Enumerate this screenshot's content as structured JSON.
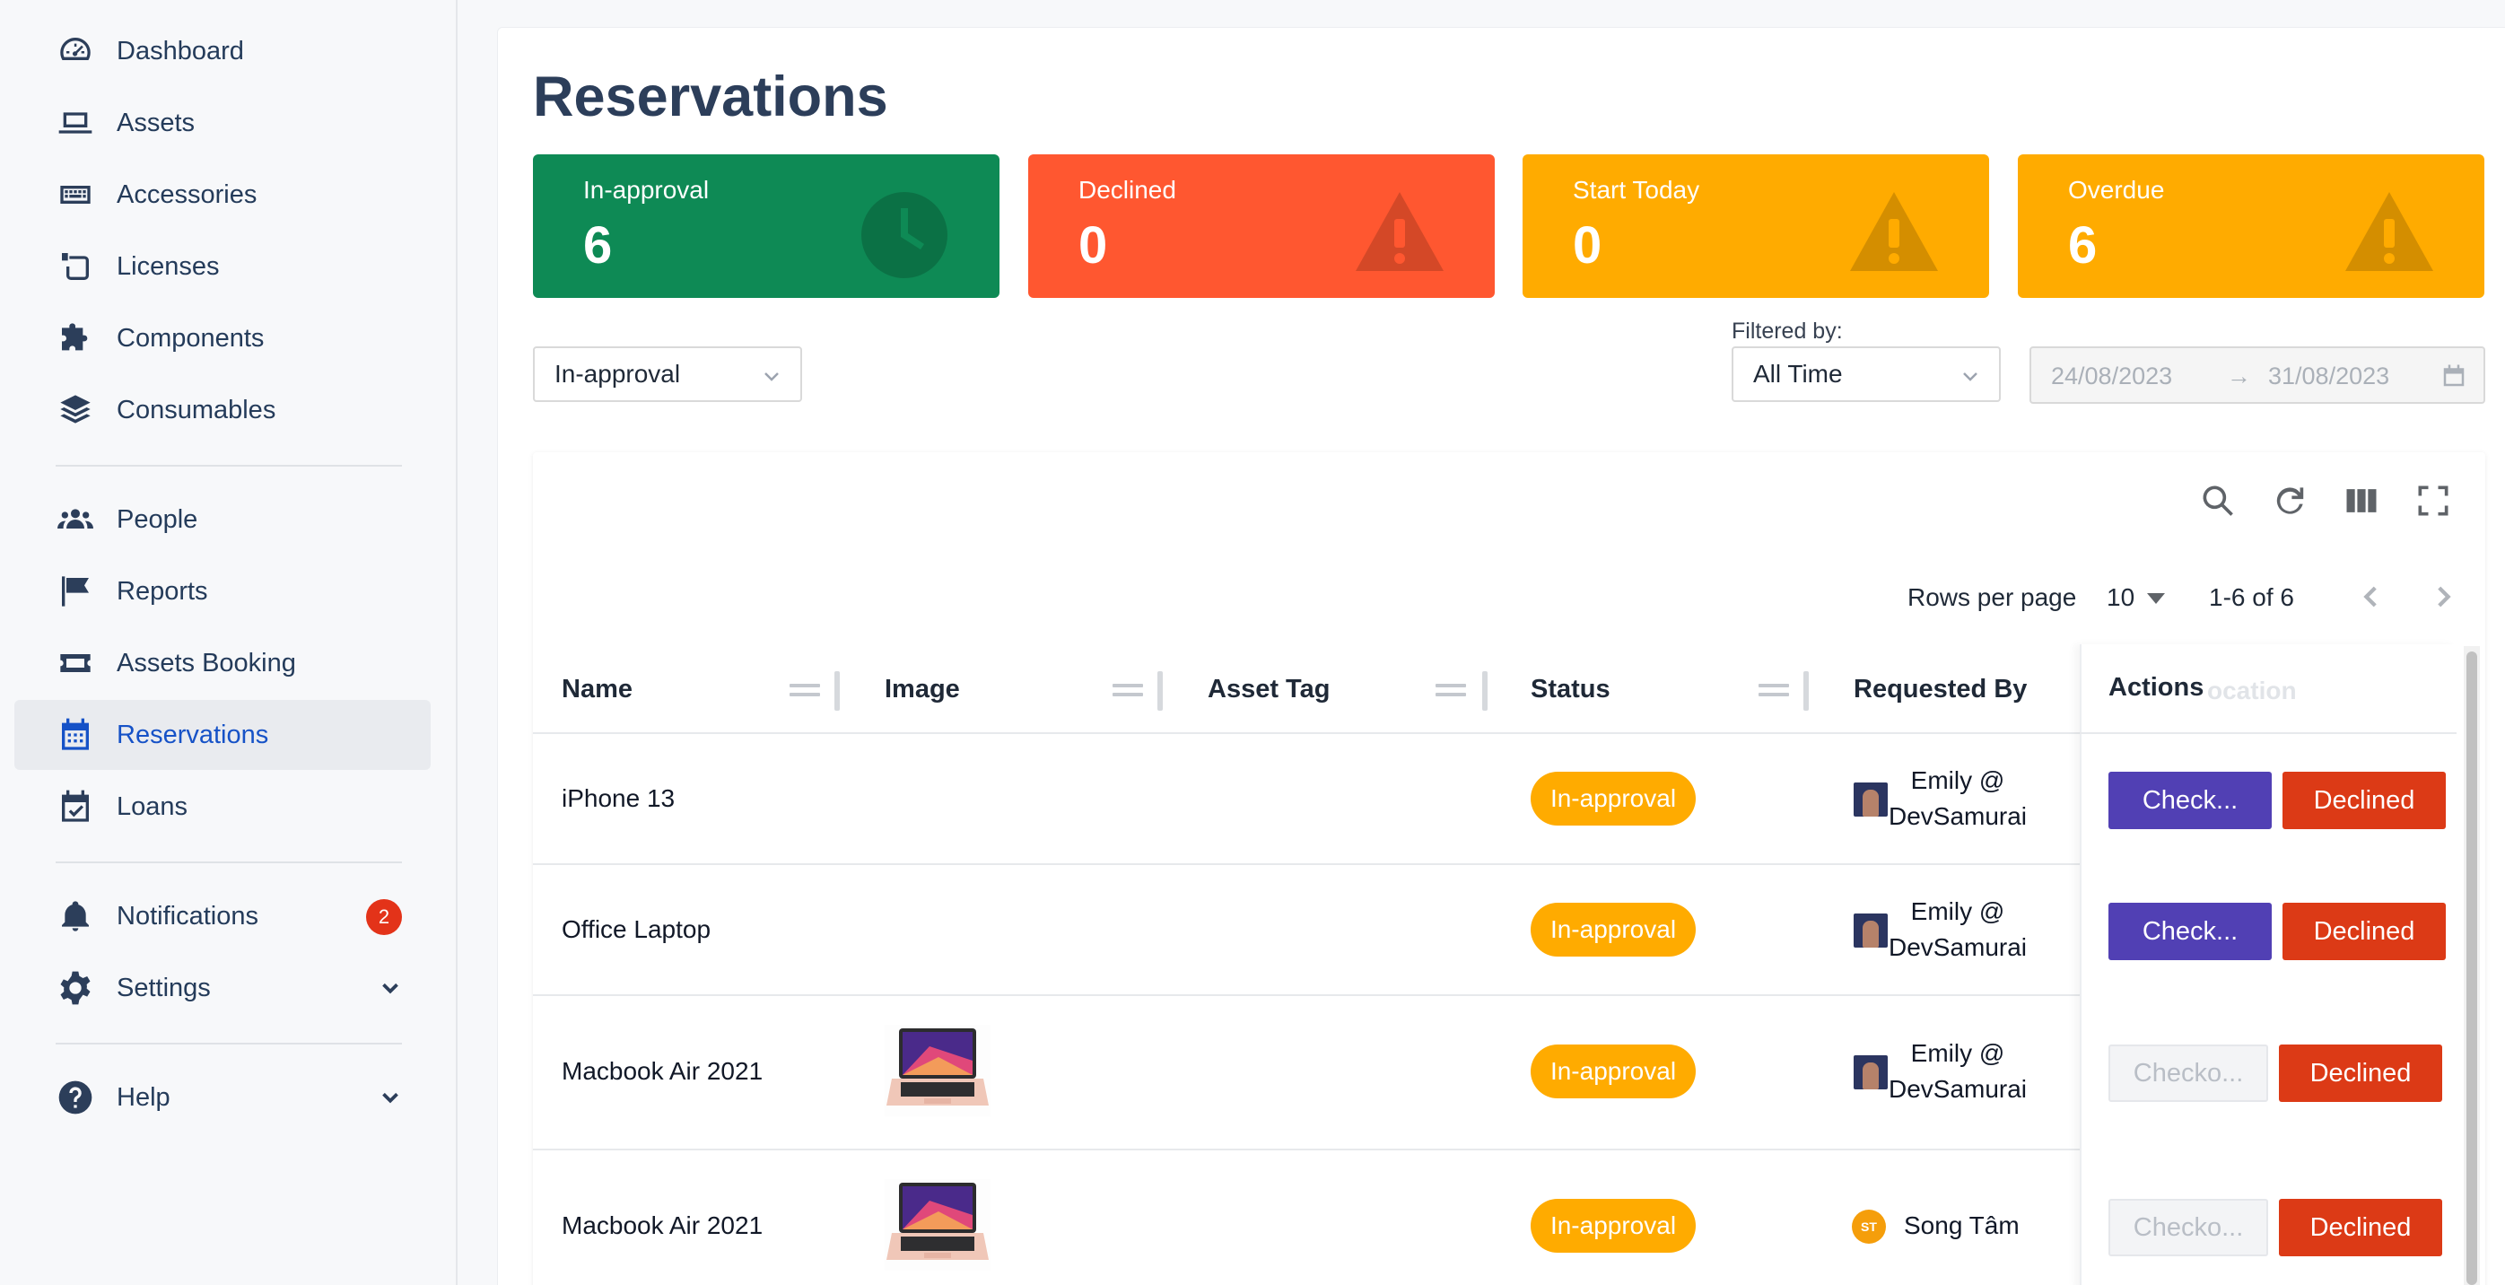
{
  "sidebar": {
    "items": [
      {
        "label": "Dashboard",
        "icon": "dashboard-icon"
      },
      {
        "label": "Assets",
        "icon": "laptop-icon"
      },
      {
        "label": "Accessories",
        "icon": "keyboard-icon"
      },
      {
        "label": "Licenses",
        "icon": "license-icon"
      },
      {
        "label": "Components",
        "icon": "puzzle-icon"
      },
      {
        "label": "Consumables",
        "icon": "layers-icon"
      },
      {
        "label": "People",
        "icon": "people-icon"
      },
      {
        "label": "Reports",
        "icon": "flag-icon"
      },
      {
        "label": "Assets Booking",
        "icon": "ticket-icon"
      },
      {
        "label": "Reservations",
        "icon": "calendar-icon"
      },
      {
        "label": "Loans",
        "icon": "calendar-check-icon"
      },
      {
        "label": "Notifications",
        "icon": "bell-icon",
        "badge": "2"
      },
      {
        "label": "Settings",
        "icon": "gear-icon"
      },
      {
        "label": "Help",
        "icon": "help-icon"
      }
    ],
    "active": "Reservations"
  },
  "page": {
    "title": "Reservations"
  },
  "cards": [
    {
      "label": "In-approval",
      "value": "6",
      "color": "#0e8a55",
      "icon": "clock-icon"
    },
    {
      "label": "Declined",
      "value": "0",
      "color": "#ff5730",
      "icon": "warning-icon"
    },
    {
      "label": "Start Today",
      "value": "0",
      "color": "#ffab00",
      "icon": "warning-icon"
    },
    {
      "label": "Overdue",
      "value": "6",
      "color": "#ffab00",
      "icon": "warning-icon"
    }
  ],
  "filters": {
    "status_value": "In-approval",
    "filtered_by_label": "Filtered by:",
    "period_value": "All Time",
    "date_start": "24/08/2023",
    "date_arrow": "→",
    "date_end": "31/08/2023"
  },
  "table": {
    "rows_per_page_label": "Rows per page",
    "rows_per_page": "10",
    "range": "1-6 of 6",
    "columns": [
      "Name",
      "Image",
      "Asset Tag",
      "Status",
      "Requested By",
      "Actions"
    ],
    "ghost_column": "ocation",
    "rows": [
      {
        "name": "iPhone 13",
        "status": "In-approval",
        "req1": "Emily @",
        "req2": "DevSamurai",
        "check": "Check...",
        "decline": "Declined"
      },
      {
        "name": "Office Laptop",
        "status": "In-approval",
        "req1": "Emily @",
        "req2": "DevSamurai",
        "check": "Check...",
        "decline": "Declined"
      },
      {
        "name": "Macbook Air 2021",
        "status": "In-approval",
        "req1": "Emily @",
        "req2": "DevSamurai",
        "check": "Checko...",
        "decline": "Declined"
      },
      {
        "name": "Macbook Air 2021",
        "status": "In-approval",
        "req1": "Song Tâm",
        "req2": "",
        "avatar_initials": "ST",
        "check": "Checko...",
        "decline": "Declined"
      }
    ]
  }
}
